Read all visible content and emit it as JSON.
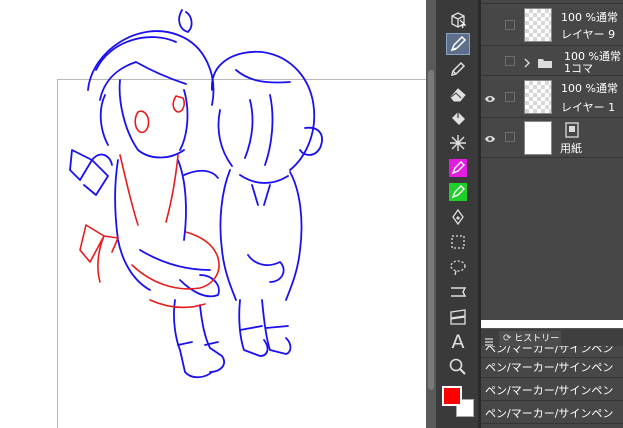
{
  "colors": {
    "pen_blue": "#1a10f0",
    "pen_red": "#e81c1c",
    "main_color": "#ff0000",
    "sub_color": "#ffffff",
    "active_tool": "#5d6f8a",
    "layer_bg": "#474747"
  },
  "toolbar": {
    "tools": [
      {
        "icon": "object-select-icon"
      },
      {
        "icon": "pen-icon",
        "active": true
      },
      {
        "icon": "pencil-icon"
      },
      {
        "icon": "eraser-icon"
      },
      {
        "icon": "fill-icon"
      },
      {
        "icon": "sparkle-icon"
      },
      {
        "icon": "magenta-marker-icon"
      },
      {
        "icon": "green-marker-icon"
      },
      {
        "icon": "vector-pen-icon"
      },
      {
        "icon": "selection-pen-icon"
      },
      {
        "icon": "lasso-icon"
      },
      {
        "icon": "ruler-icon"
      },
      {
        "icon": "frame-icon"
      },
      {
        "icon": "text-icon",
        "glyph": "A"
      },
      {
        "icon": "zoom-icon"
      }
    ]
  },
  "layers": [
    {
      "blend": "100 %通常",
      "name": "レイヤー 9",
      "visible": false,
      "type": "raster"
    },
    {
      "blend": "100 %通常",
      "name": "1コマ",
      "visible": false,
      "type": "folder"
    },
    {
      "blend": "100 %通常",
      "name": "レイヤー 1",
      "visible": true,
      "type": "raster"
    },
    {
      "blend": "",
      "name": "用紙",
      "visible": true,
      "type": "paper"
    }
  ],
  "history": {
    "tab_label": "ヒストリー",
    "items": [
      "ペン/マーカー/サインペン",
      "ペン/マーカー/サインペン",
      "ペン/マーカー/サインペン",
      "ペン/マーカー/サインペン"
    ]
  }
}
